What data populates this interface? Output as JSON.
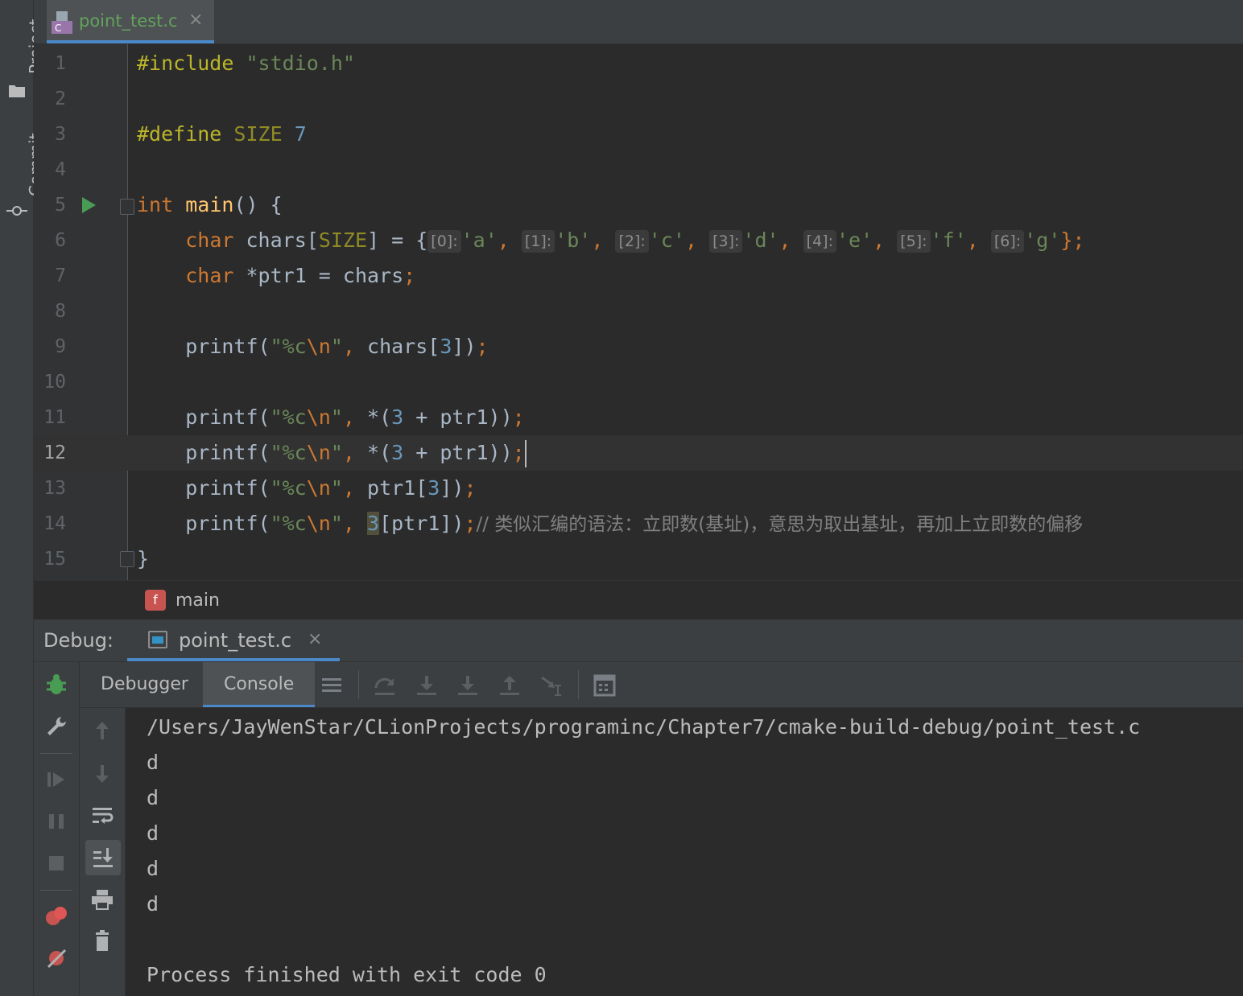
{
  "sidebar": {
    "project_label": "Project",
    "commit_label": "Commit"
  },
  "editor_tab": {
    "filename": "point_test.c",
    "icon": "c-file-icon",
    "close": "×"
  },
  "editor": {
    "current_line": 12,
    "line_numbers": [
      "1",
      "2",
      "3",
      "4",
      "5",
      "6",
      "7",
      "8",
      "9",
      "10",
      "11",
      "12",
      "13",
      "14",
      "15"
    ],
    "code": {
      "l1_include": "#include",
      "l1_header": "\"stdio.h\"",
      "l3_define": "#define",
      "l3_macro": "SIZE",
      "l3_value": "7",
      "l5_type": "int",
      "l5_name": "main",
      "l5_rest": "() {",
      "l6_type": "char",
      "l6_var": " chars[",
      "l6_macro": "SIZE",
      "l6_assign": "] = {",
      "l6_hints": [
        "[0]:",
        "[1]:",
        "[2]:",
        "[3]:",
        "[4]:",
        "[5]:",
        "[6]:"
      ],
      "l6_values": [
        "'a'",
        "'b'",
        "'c'",
        "'d'",
        "'e'",
        "'f'",
        "'g'"
      ],
      "l6_end": "};",
      "l7_type": "char",
      "l7_rest": " *ptr1 = chars",
      "l7_semi": ";",
      "printf": "printf(",
      "fmt_open": "\"%c",
      "fmt_esc": "\\n",
      "fmt_close": "\"",
      "comma": ", ",
      "l9_arg": "chars[",
      "l9_idx": "3",
      "l9_close": "])",
      "semi": ";",
      "l11_arg1": "*(",
      "l11_num": "3",
      "l11_arg2": " + ptr1))",
      "l13_arg": "ptr1[",
      "l13_idx": "3",
      "l13_close": "])",
      "l14_num": "3",
      "l14_arg": "[ptr1])",
      "l14_comment": "// 类似汇编的语法：立即数(基址)，意思为取出基址，再加上立即数的偏移",
      "l15_brace": "}"
    }
  },
  "breadcrumb": {
    "badge": "f",
    "function": "main"
  },
  "debug": {
    "label": "Debug:",
    "tab_name": "point_test.c",
    "close": "×",
    "tabs": [
      "Debugger",
      "Console"
    ],
    "active_tab": "Console"
  },
  "console": {
    "lines": [
      "/Users/JayWenStar/CLionProjects/programinc/Chapter7/cmake-build-debug/point_test.c",
      "d",
      "d",
      "d",
      "d",
      "d",
      "",
      "Process finished with exit code 0"
    ]
  },
  "colors": {
    "background": "#2b2b2b",
    "panel": "#3c3f41",
    "keyword": "#cc7832",
    "string": "#6a8759",
    "number": "#6897bb",
    "function": "#ffc66d",
    "accent": "#4a88c7",
    "run_green": "#499c54"
  }
}
